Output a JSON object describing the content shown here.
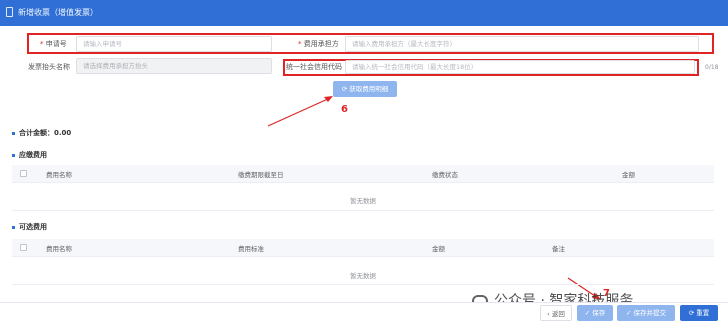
{
  "window": {
    "title": "新增收票（增值发票）"
  },
  "form": {
    "apply_no": {
      "label": "申请号",
      "placeholder": "请输入申请号"
    },
    "fee_payer": {
      "label": "费用承担方",
      "placeholder": "请输入费用承担方（最大长度字符）"
    },
    "invoice_name": {
      "label": "发票抬头名称",
      "placeholder": "请选择费用承担方抬头"
    },
    "credit_code": {
      "label": "统一社会信用代码",
      "placeholder": "请输入统一社会信用代码（最大长度18位）",
      "counter": "0/18"
    },
    "fetch_button": "获取费用明细"
  },
  "annotations": {
    "marker_6": "6",
    "marker_7": "7"
  },
  "summary": {
    "total": "合计金额：0.00"
  },
  "payable": {
    "title": "应缴费用",
    "columns": [
      "费用名称",
      "缴费期限截至日",
      "缴费状态",
      "金额"
    ],
    "empty": "暂无数据"
  },
  "optional": {
    "title": "可选费用",
    "columns": [
      "费用名称",
      "费用标准",
      "金额",
      "备注"
    ],
    "empty": "暂无数据"
  },
  "footer": {
    "back": "返回",
    "save": "保存",
    "save_submit": "保存并提交",
    "reset": "重置"
  },
  "watermark": {
    "text": "公众号 · 智家科技服务"
  },
  "colors": {
    "primary": "#2f6fd6",
    "annotation": "#e02424"
  }
}
